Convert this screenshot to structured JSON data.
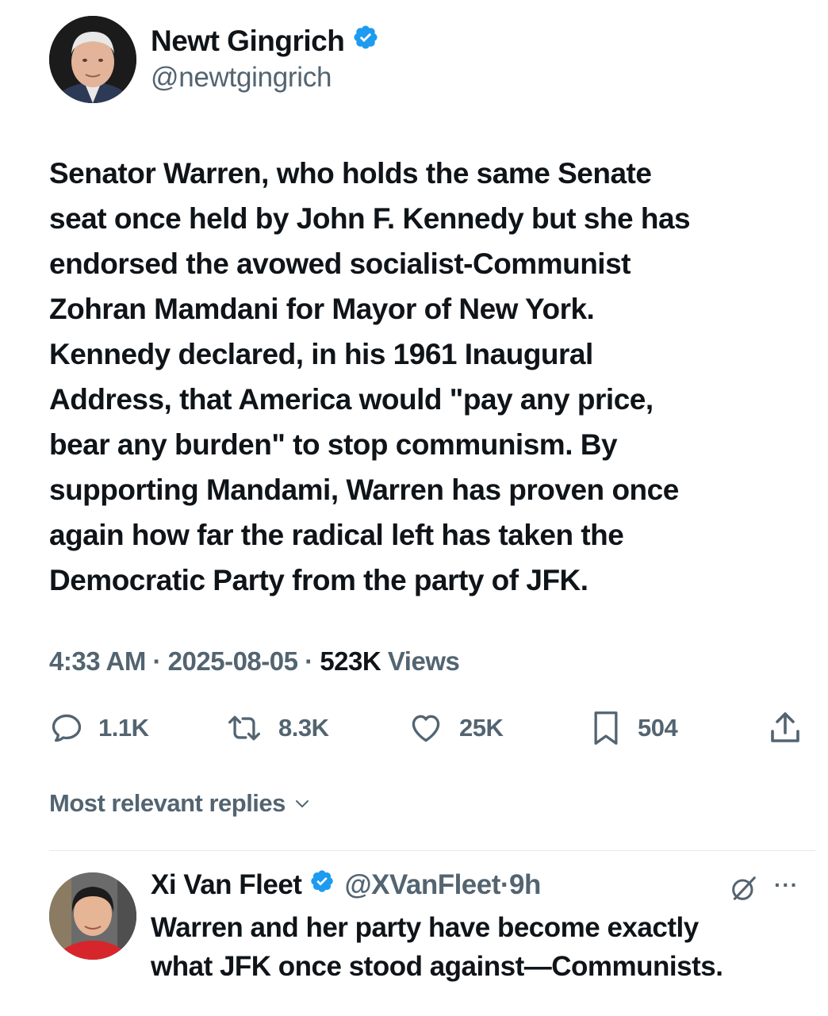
{
  "author": {
    "name": "Newt Gingrich",
    "handle": "@newtgingrich",
    "verified": true
  },
  "tweet": {
    "lines": [
      "Senator Warren, who holds the same Senate",
      "seat once held by John F. Kennedy but she has",
      "endorsed the avowed socialist-Communist",
      "Zohran Mamdani for Mayor of New York.",
      "Kennedy declared, in his 1961 Inaugural",
      "Address, that America would \"pay any price,",
      "bear any burden\" to stop communism. By",
      "supporting Mandami, Warren has proven once",
      "again how far the radical left has taken the",
      "Democratic Party from the party of JFK."
    ],
    "time": "4:33 AM",
    "date": "2025-08-05",
    "views_count": "523K",
    "views_label": "Views",
    "separator": "·"
  },
  "actions": {
    "replies": "1.1K",
    "reposts": "8.3K",
    "likes": "25K",
    "bookmarks": "504"
  },
  "replies_sort": {
    "label": "Most relevant replies"
  },
  "reply": {
    "name": "Xi Van Fleet",
    "handle": "@XVanFleet",
    "separator": "·",
    "age": "9h",
    "verified": true,
    "lines": [
      "Warren and her party have become exactly",
      "what JFK once stood against—Communists."
    ],
    "more": "···"
  },
  "colors": {
    "text": "#0f1419",
    "secondary": "#536471",
    "verified_blue": "#1d9bf0",
    "background": "#ffffff"
  },
  "icons": [
    "reply-icon",
    "repost-icon",
    "like-icon",
    "bookmark-icon",
    "share-icon",
    "verified-badge-icon",
    "chevron-down-icon",
    "grok-icon",
    "more-icon"
  ]
}
